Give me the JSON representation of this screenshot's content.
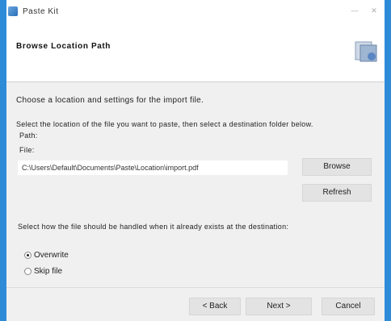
{
  "window": {
    "title": "Paste Kit",
    "minimize_glyph": "—",
    "close_glyph": "✕"
  },
  "header": {
    "title": "Browse Location Path",
    "icon": "wizard-icon"
  },
  "content": {
    "instruction": "Choose a location and settings for the import file.",
    "description_line1": "Select the location of the file you want to paste, then select a destination folder below.",
    "description_line2": "Path:",
    "path_label": "File:",
    "path_value": "C:\\Users\\Default\\Documents\\Paste\\Location\\import.pdf",
    "browse_label": "Browse",
    "refresh_label": "Refresh",
    "option_prompt": "Select how the file should be handled when it already exists at the destination:",
    "options": [
      {
        "label": "Overwrite",
        "checked": true
      },
      {
        "label": "Skip file",
        "checked": false
      }
    ]
  },
  "footer": {
    "back_label": "< Back",
    "next_label": "Next >",
    "cancel_label": "Cancel"
  },
  "colors": {
    "border": "#2e8bd8",
    "background": "#f0f0f0",
    "button": "#e3e3e3"
  }
}
